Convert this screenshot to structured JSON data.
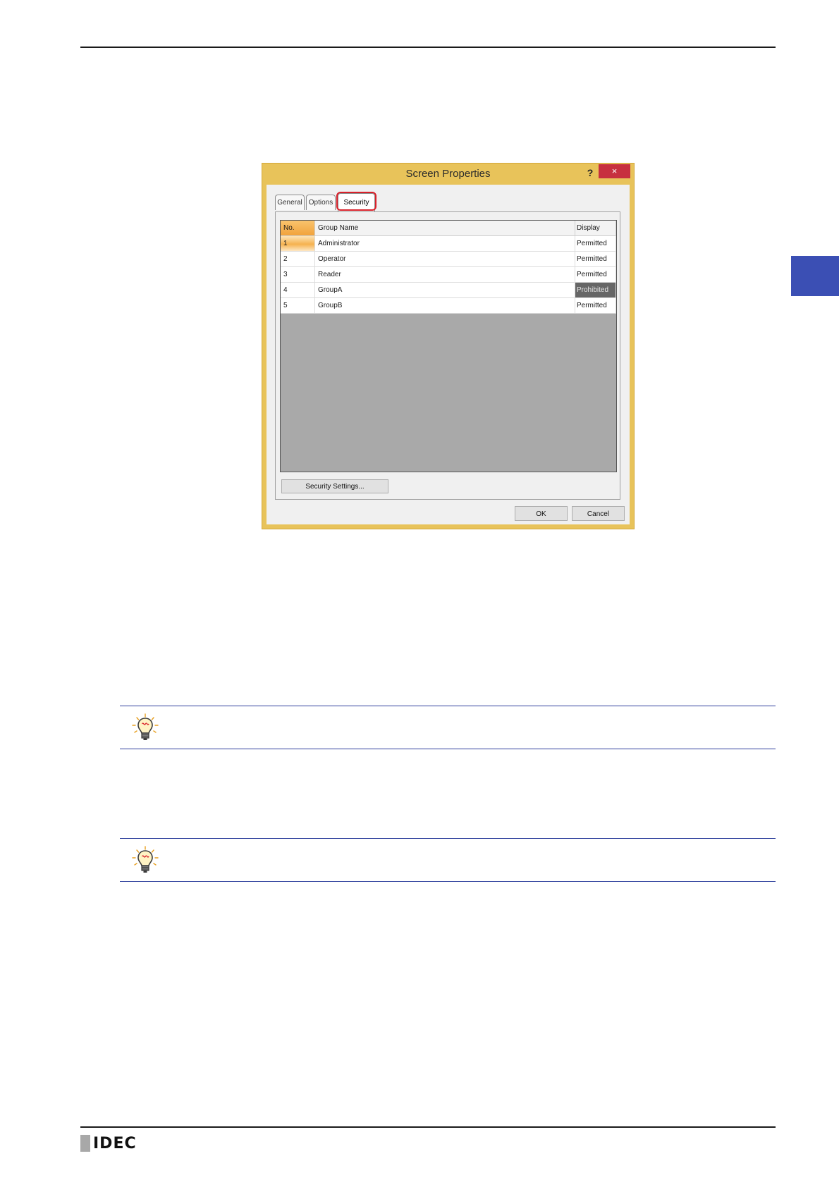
{
  "dialog": {
    "title": "Screen Properties",
    "help_label": "?",
    "close_label": "×",
    "tabs": [
      {
        "label": "General"
      },
      {
        "label": "Options"
      },
      {
        "label": "Security"
      }
    ],
    "active_tab": "Security",
    "grid": {
      "columns": [
        "No.",
        "Group Name",
        "Display"
      ],
      "rows": [
        {
          "no": "1",
          "name": "Administrator",
          "display": "Permitted"
        },
        {
          "no": "2",
          "name": "Operator",
          "display": "Permitted"
        },
        {
          "no": "3",
          "name": "Reader",
          "display": "Permitted"
        },
        {
          "no": "4",
          "name": "GroupA",
          "display": "Prohibited"
        },
        {
          "no": "5",
          "name": "GroupB",
          "display": "Permitted"
        }
      ]
    },
    "security_settings_button": "Security Settings...",
    "ok_button": "OK",
    "cancel_button": "Cancel"
  },
  "footer": {
    "logo_text": "IDEC"
  },
  "colors": {
    "dialog_frame": "#e8c35a",
    "close_button": "#c7303f",
    "highlight": "#d8202a",
    "side_tab": "#3b4fb4",
    "hint_rule": "#2e3f9c"
  },
  "icons": [
    "lightbulb-icon",
    "lightbulb-icon"
  ]
}
